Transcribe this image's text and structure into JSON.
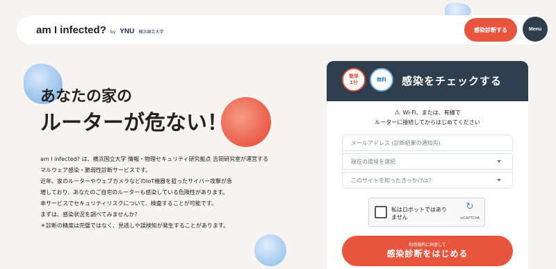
{
  "header": {
    "logo_main": "am I infected?",
    "logo_by": "by",
    "logo_ynu": "YNU",
    "logo_univ": "横浜国立大学",
    "diagnosis_button": "感染診断する",
    "menu_button": "Menu"
  },
  "hero": {
    "title_line1": "あなたの家の",
    "title_line2": "ルーターが危ない！",
    "description": [
      "am I infected? は、横浜国立大学 情報・物理セキュリティ研究拠点 吉岡研究室が運営する",
      "マルウェア感染・脆弱性診断サービスです。",
      "近年、家のルーターやウェブカメラなどのIoT機器を狙ったサイバー攻撃が急",
      "増しており、あなたのご自宅のルーターも感染している危険性があります。",
      "本サービスでセキュリティリスクについて、検査することが可能です。",
      "まずは、感染状況を調べてみませんか？",
      "＊診断の精度は完璧ではなく、見逃しや誤検知が発生することがあります。"
    ]
  },
  "card": {
    "badge_easy_line1": "簡単",
    "badge_easy_line2": "1分",
    "badge_free": "無料",
    "title": "感染をチェックする",
    "notice_icon": "warning-icon",
    "notice_line1": "Wi-Fi、または、有線で",
    "notice_line2": "ルーターに接続してからはじめてください",
    "email_placeholder": "メールアドレス (診断結果の通知先)",
    "environment_select": "現在の環境を選択",
    "trigger_select": "このサイトを知ったきっかけは？",
    "captcha_label_line1": "私はロボットではあり",
    "captcha_label_line2": "ません",
    "captcha_brand": "reCAPTCHA",
    "start_sub": "利用規約に同意して",
    "start_main": "感染診断をはじめる"
  },
  "colors": {
    "accent": "#e8553e",
    "navy": "#2e3e4c",
    "background": "#f6f3f0"
  }
}
